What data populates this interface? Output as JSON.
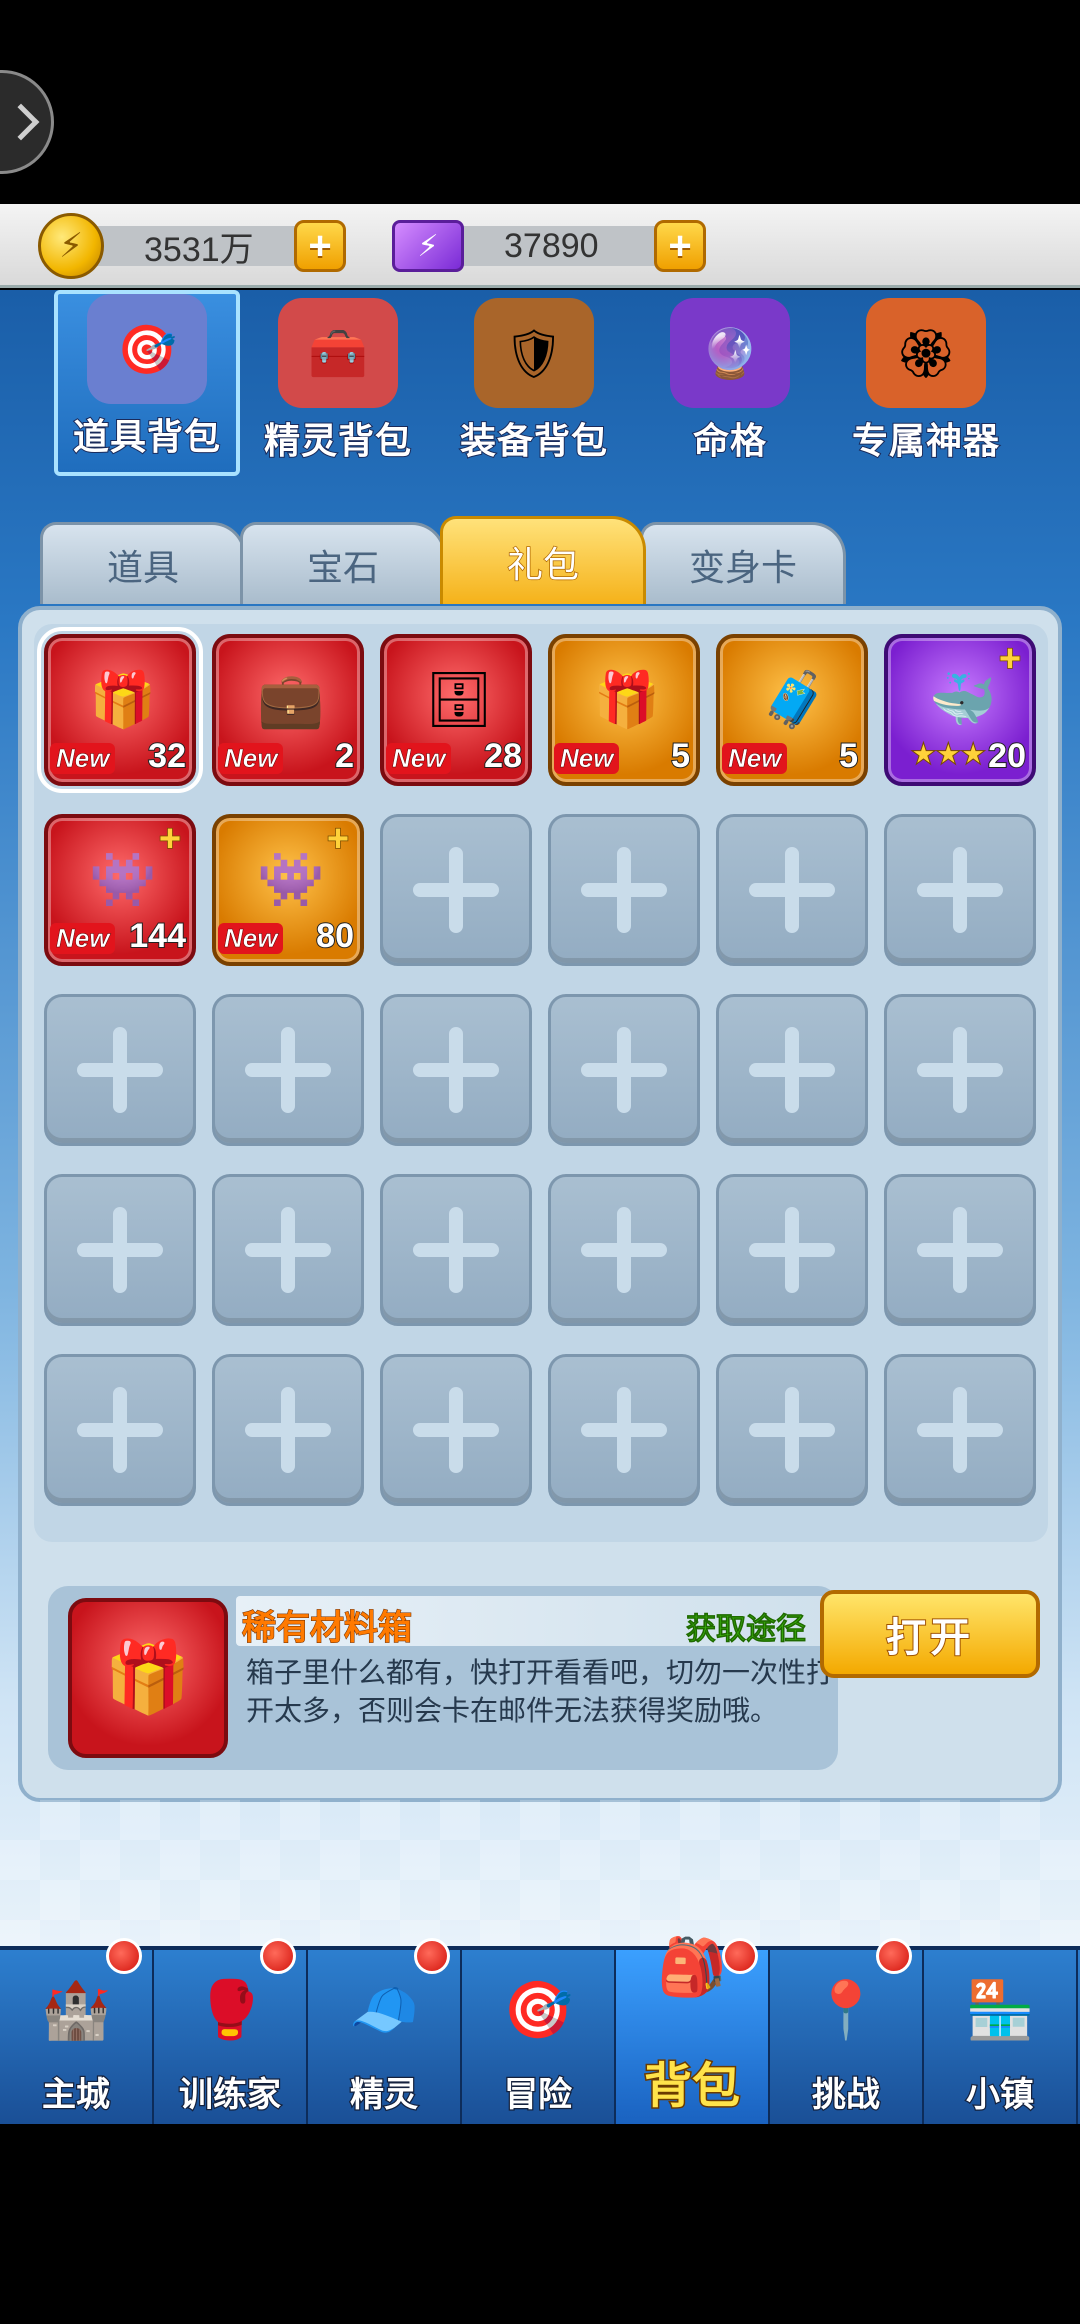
{
  "currency": {
    "gold": "3531万",
    "gems": "37890"
  },
  "categories": [
    {
      "label": "道具背包",
      "icon": "toolbox-icon",
      "emoji": "🎯",
      "bg": "#6a7fd0",
      "active": true
    },
    {
      "label": "精灵背包",
      "icon": "sprite-chest-icon",
      "emoji": "🧰",
      "bg": "#d24a4a",
      "active": false
    },
    {
      "label": "装备背包",
      "icon": "equipment-chest-icon",
      "emoji": "🛡",
      "bg": "#a9652a",
      "active": false
    },
    {
      "label": "命格",
      "icon": "crystal-orb-icon",
      "emoji": "🔮",
      "bg": "#7a39c9",
      "active": false
    },
    {
      "label": "专属神器",
      "icon": "artifact-badge-icon",
      "emoji": "🏵",
      "bg": "#d9622a",
      "active": false
    }
  ],
  "sub_tabs": [
    {
      "label": "道具",
      "active": false
    },
    {
      "label": "宝石",
      "active": false
    },
    {
      "label": "礼包",
      "active": true
    },
    {
      "label": "变身卡",
      "active": false
    }
  ],
  "items": [
    {
      "name": "gift-box-gold",
      "color": "red",
      "emoji": "🎁",
      "new": "New",
      "count": "32",
      "selected": true
    },
    {
      "name": "red-treasure-chest",
      "color": "red",
      "emoji": "💼",
      "new": "New",
      "count": "2",
      "selected": false
    },
    {
      "name": "purple-chest",
      "color": "red",
      "emoji": "🗄",
      "new": "New",
      "count": "28",
      "selected": false
    },
    {
      "name": "blue-gift-box",
      "color": "orange",
      "emoji": "🎁",
      "new": "New",
      "count": "5",
      "selected": false
    },
    {
      "name": "silver-chest",
      "color": "orange",
      "emoji": "🧳",
      "new": "New",
      "count": "5",
      "selected": false
    },
    {
      "name": "blue-sprite-card",
      "color": "purple",
      "emoji": "🐳",
      "new": "",
      "count": "20",
      "stars": "★★★",
      "plus": true,
      "selected": false
    },
    {
      "name": "purple-sprite-card-red",
      "color": "red",
      "emoji": "👾",
      "new": "New",
      "count": "144",
      "plus": true,
      "selected": false
    },
    {
      "name": "purple-sprite-card-orange",
      "color": "orange",
      "emoji": "👾",
      "new": "New",
      "count": "80",
      "plus": true,
      "selected": false
    }
  ],
  "empty_slots": 22,
  "detail": {
    "name": "稀有材料箱",
    "source": "获取途径",
    "description": "箱子里什么都有，快打开看看吧，切勿一次性打开太多，否则会卡在邮件无法获得奖励哦。",
    "icon_emoji": "🎁"
  },
  "open_button": "打开",
  "bottom_nav": [
    {
      "label": "主城",
      "icon": "main-city-icon",
      "emoji": "🏰",
      "active": false,
      "dot": true
    },
    {
      "label": "训练家",
      "icon": "trainer-glove-icon",
      "emoji": "🥊",
      "active": false,
      "dot": true
    },
    {
      "label": "精灵",
      "icon": "sprite-face-icon",
      "emoji": "🧢",
      "active": false,
      "dot": true
    },
    {
      "label": "冒险",
      "icon": "adventure-target-icon",
      "emoji": "🎯",
      "active": false,
      "dot": false
    },
    {
      "label": "背包",
      "icon": "backpack-icon",
      "emoji": "🎒",
      "active": true,
      "dot": true
    },
    {
      "label": "挑战",
      "icon": "challenge-map-icon",
      "emoji": "📍",
      "active": false,
      "dot": true
    },
    {
      "label": "小镇",
      "icon": "town-shop-icon",
      "emoji": "🏪",
      "active": false,
      "dot": false
    }
  ]
}
